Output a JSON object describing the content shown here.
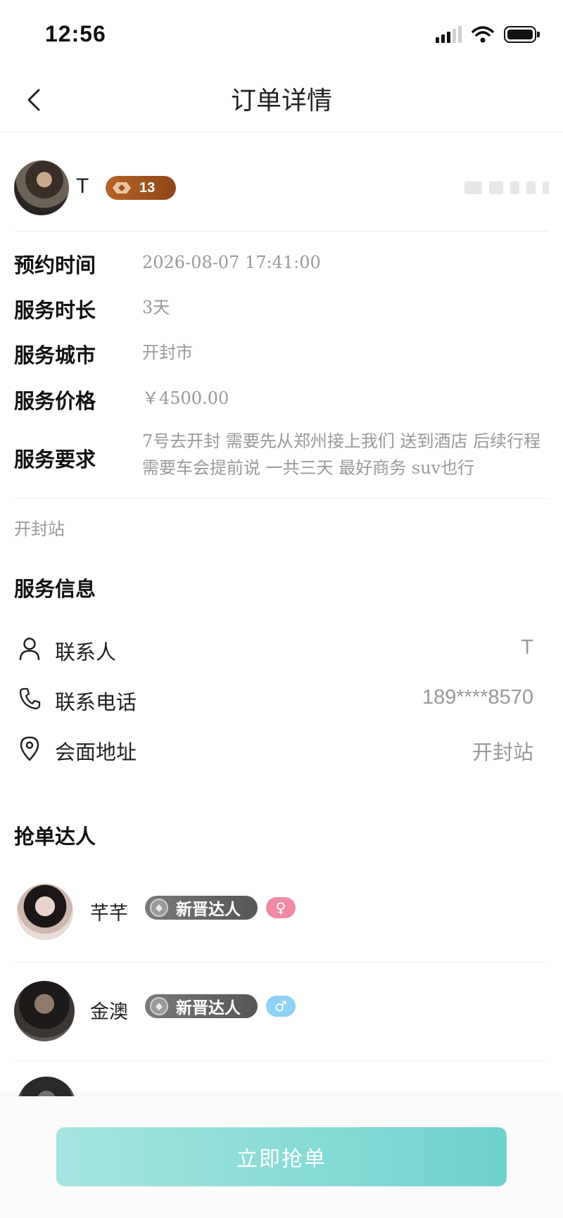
{
  "status_bar": {
    "time": "12:56"
  },
  "nav": {
    "title": "订单详情"
  },
  "user": {
    "name": "T",
    "level": "13"
  },
  "details": [
    {
      "label": "预约时间",
      "value": "2026-08-07 17:41:00"
    },
    {
      "label": "服务时长",
      "value": "3天"
    },
    {
      "label": "服务城市",
      "value": "开封市"
    },
    {
      "label": "服务价格",
      "value": "￥4500.00"
    },
    {
      "label": "服务要求",
      "value": "7号去开封 需要先从郑州接上我们 送到酒店 后续行程需要车会提前说 一共三天 最好商务 suv也行"
    }
  ],
  "station": "开封站",
  "service_info": {
    "title": "服务信息",
    "items": [
      {
        "label": "联系人",
        "value": "T",
        "icon": "person-icon"
      },
      {
        "label": "联系电话",
        "value": "189****8570",
        "icon": "phone-icon"
      },
      {
        "label": "会面地址",
        "value": "开封站",
        "icon": "location-pin-icon"
      }
    ]
  },
  "grabbers": {
    "title": "抢单达人",
    "items": [
      {
        "name": "芊芊",
        "tag": "新晋达人",
        "gender": "♀"
      },
      {
        "name": "金澳",
        "tag": "新晋达人",
        "gender": "♂"
      }
    ]
  },
  "action": {
    "grab_label": "立即抢单"
  },
  "colors": {
    "accent": "#6fd2cf",
    "level_badge": "#a5561f",
    "female": "#f08aa5",
    "male": "#8fd0f5"
  }
}
